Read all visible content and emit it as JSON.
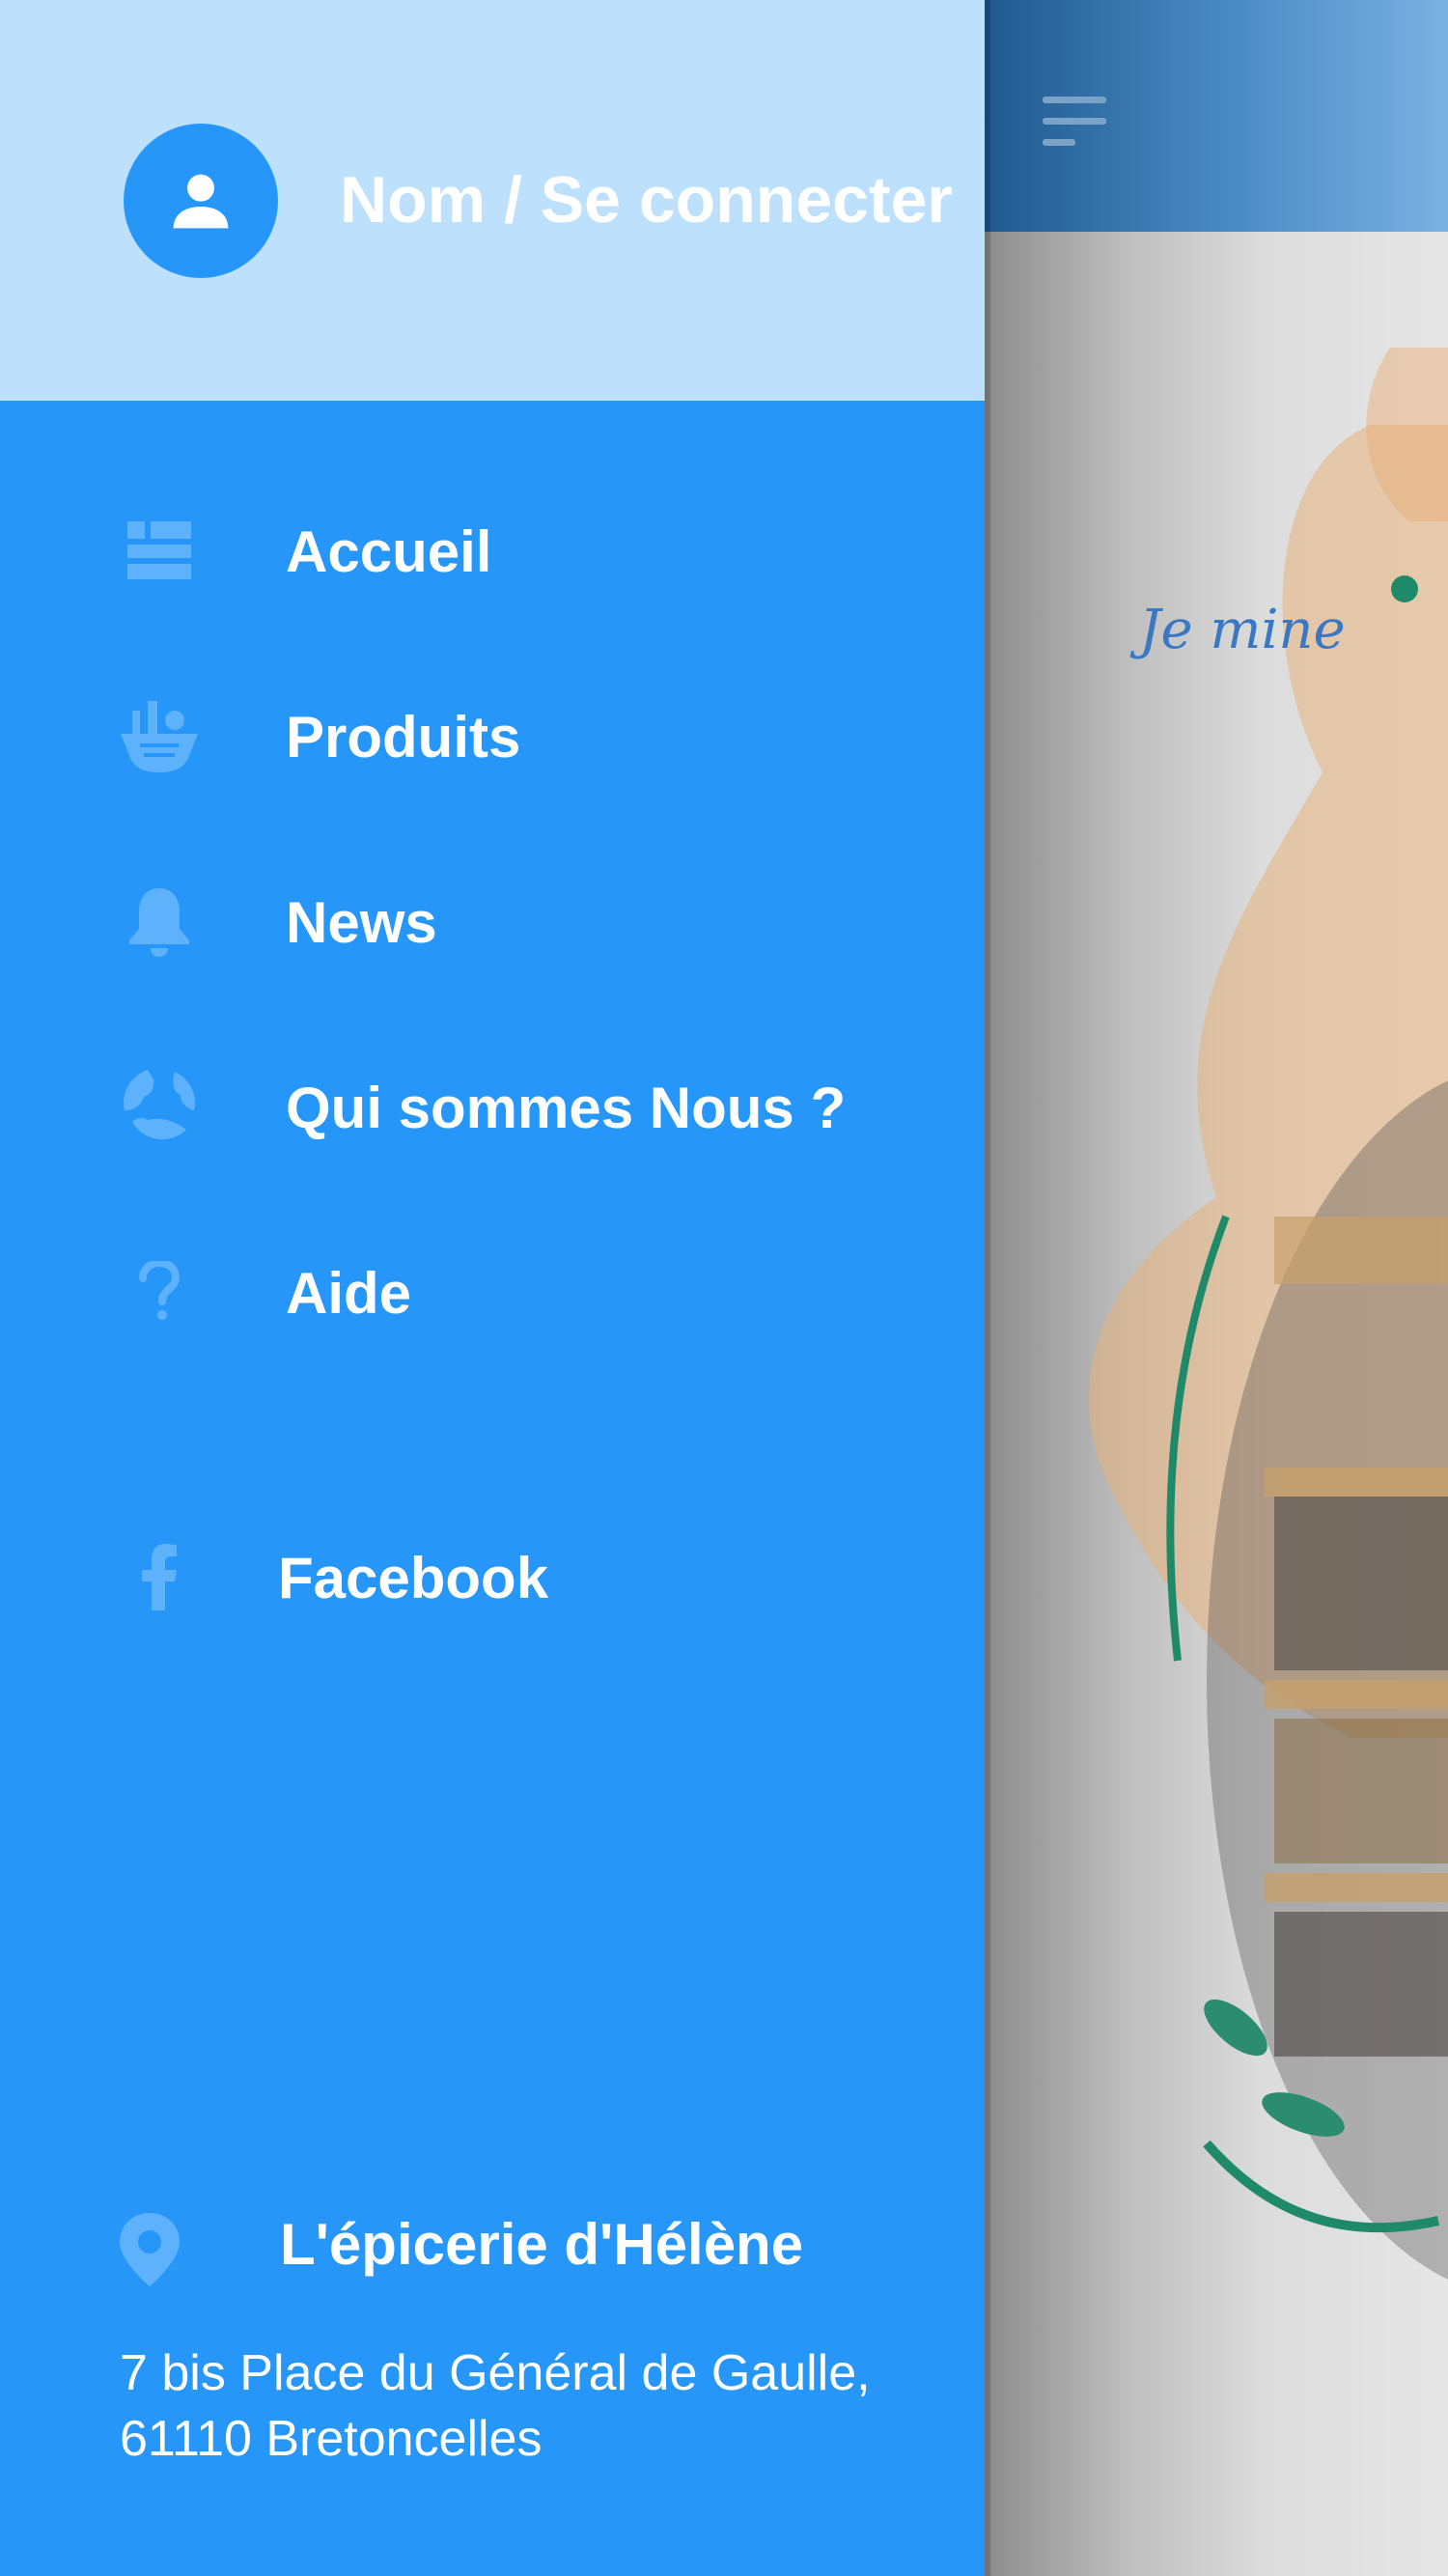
{
  "drawer": {
    "header": {
      "login_label": "Nom / Se connecter",
      "avatar_icon": "person-icon"
    },
    "menu": [
      {
        "label": "Accueil",
        "icon": "dashboard-icon"
      },
      {
        "label": "Produits",
        "icon": "basket-icon"
      },
      {
        "label": "News",
        "icon": "bell-icon"
      },
      {
        "label": "Qui sommes Nous ?",
        "icon": "globe-leaf-icon"
      },
      {
        "label": "Aide",
        "icon": "question-icon"
      },
      {
        "label": "Facebook",
        "icon": "facebook-icon"
      }
    ],
    "store": {
      "name": "L'épicerie d'Hélène",
      "address": "7 bis Place du Général de Gaulle, 61110 Bretoncelles",
      "icon": "location-pin-icon"
    }
  },
  "background_app": {
    "tagline": "Je mine",
    "menu_icon": "hamburger-icon"
  },
  "colors": {
    "drawer_bg": "#2697f8",
    "drawer_header_bg": "#bde0fd",
    "icon_color": "#5eb1fb",
    "text": "#ffffff"
  }
}
